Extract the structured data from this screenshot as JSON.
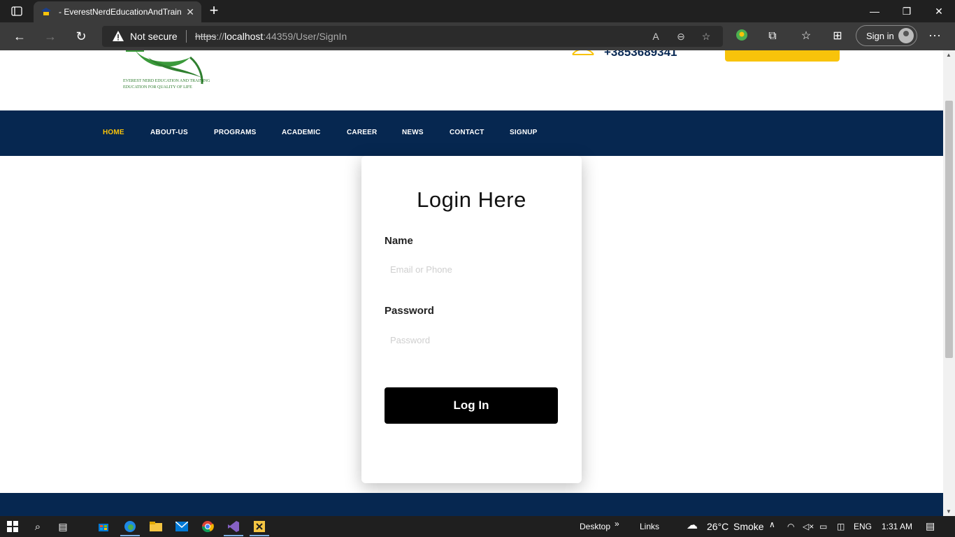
{
  "browser": {
    "tab_title": "- EverestNerdEducationAndTrain",
    "security_label": "Not secure",
    "url_protocol": "https",
    "url_separator": "://",
    "url_host": "localhost",
    "url_path": ":44359/User/SignIn",
    "signin_label": "Sign in"
  },
  "header": {
    "logo_line1": "EVEREST NERD EDUCATION AND TRAINING",
    "logo_line2": "EDUCATION FOR QUALITY OF LIFE",
    "phone": "+3853689341"
  },
  "nav": {
    "items": [
      {
        "label": "HOME",
        "active": true
      },
      {
        "label": "ABOUT-US"
      },
      {
        "label": "PROGRAMS"
      },
      {
        "label": "ACADEMIC"
      },
      {
        "label": "CAREER"
      },
      {
        "label": "NEWS"
      },
      {
        "label": "CONTACT"
      },
      {
        "label": "SIGNUP"
      }
    ]
  },
  "login": {
    "title": "Login Here",
    "name_label": "Name",
    "name_placeholder": "Email or Phone",
    "password_label": "Password",
    "password_placeholder": "Password",
    "button_label": "Log In"
  },
  "taskbar": {
    "desktop_label": "Desktop",
    "links_label": "Links",
    "temperature": "26°C",
    "weather": "Smoke",
    "language": "ENG",
    "time": "1:31 AM"
  },
  "colors": {
    "navy": "#062750",
    "accent_yellow": "#f8c30a",
    "button_black": "#000000"
  }
}
